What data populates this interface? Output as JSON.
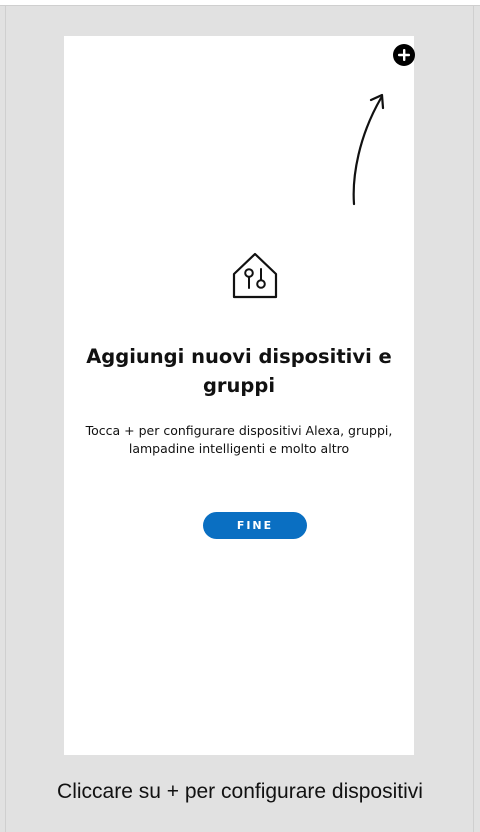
{
  "screen": {
    "title_line": "Aggiungi nuovi dispositivi\ne gruppi",
    "title": "Aggiungi nuovi dispositivi e gruppi",
    "description": "Tocca + per configurare dispositivi Alexa, gruppi, lampadine intelligenti e molto altro",
    "done_button_label": "FINE",
    "add_button_icon": "plus-circle-icon",
    "illustration_icon": "smart-home-icon"
  },
  "annotation": {
    "caption": "Cliccare su + per configurare dispositivi",
    "arrow_icon": "arrow-up-icon"
  },
  "colors": {
    "accent": "#0a6fc2",
    "background": "#e1e1e1",
    "screen": "#ffffff",
    "text": "#111111"
  }
}
